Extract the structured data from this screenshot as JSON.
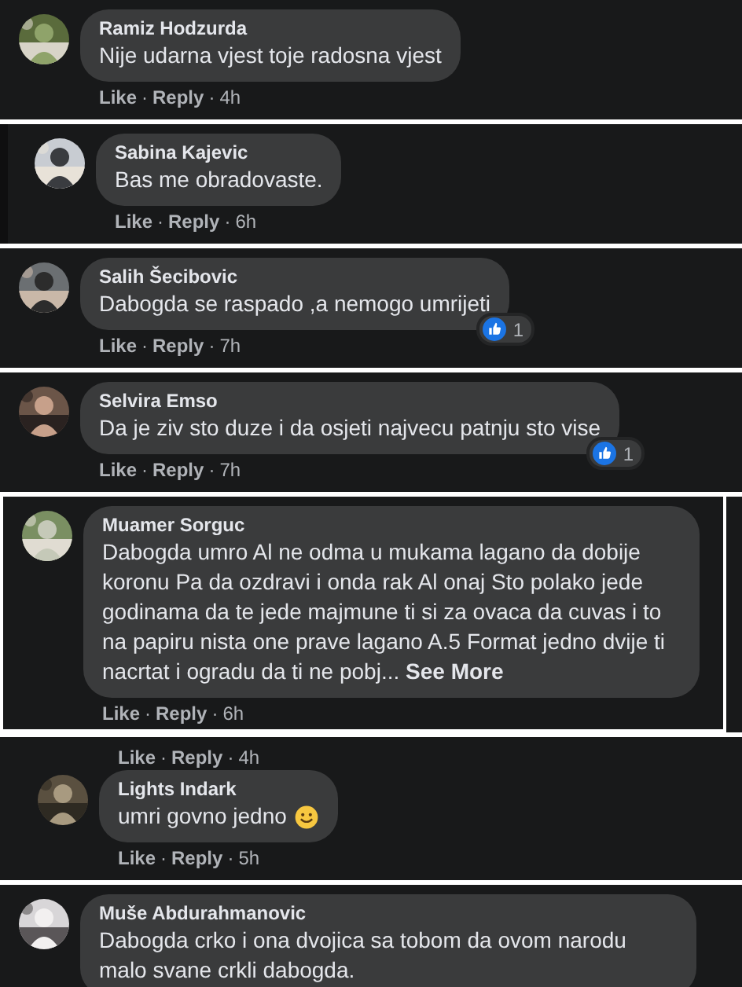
{
  "strips": [
    {
      "kind": "plain",
      "comment": {
        "reply": false,
        "author": "Ramiz Hodzurda",
        "text": "Nije udarna vjest toje radosna vjest",
        "actions": [
          {
            "kind": "link",
            "text": "Like"
          },
          {
            "kind": "dot",
            "text": "·"
          },
          {
            "kind": "link",
            "text": "Reply"
          },
          {
            "kind": "dot",
            "text": "·"
          },
          {
            "kind": "time",
            "text": "4h"
          }
        ]
      }
    },
    {
      "kind": "banded",
      "comment": {
        "reply": true,
        "author": "Sabina Kajevic",
        "text": "Bas me obradovaste.",
        "actions": [
          {
            "kind": "link",
            "text": "Like"
          },
          {
            "kind": "dot",
            "text": "·"
          },
          {
            "kind": "link",
            "text": "Reply"
          },
          {
            "kind": "dot",
            "text": "·"
          },
          {
            "kind": "time",
            "text": "6h"
          }
        ]
      }
    },
    {
      "kind": "plain",
      "comment": {
        "reply": false,
        "author": "Salih Šecibovic",
        "text": "Dabogda se raspado ,a nemogo umrijeti",
        "reaction_count": "1",
        "actions": [
          {
            "kind": "link",
            "text": "Like"
          },
          {
            "kind": "dot",
            "text": "·"
          },
          {
            "kind": "link",
            "text": "Reply"
          },
          {
            "kind": "dot",
            "text": "·"
          },
          {
            "kind": "time",
            "text": "7h"
          }
        ]
      }
    },
    {
      "kind": "plain",
      "comment": {
        "reply": false,
        "author": "Selvira Emso",
        "text": "Da je ziv sto duze i da osjeti najvecu patnju sto vise",
        "reaction_count": "1",
        "actions": [
          {
            "kind": "link",
            "text": "Like"
          },
          {
            "kind": "dot",
            "text": "·"
          },
          {
            "kind": "link",
            "text": "Reply"
          },
          {
            "kind": "dot",
            "text": "·"
          },
          {
            "kind": "time",
            "text": "7h"
          }
        ]
      }
    },
    {
      "kind": "framed",
      "comment": {
        "reply": false,
        "author": "Muamer Sorguc",
        "text": "Dabogda umro Al ne odma u mukama lagano da dobije koronu Pa da ozdravi i onda rak Al onaj Sto polako jede godinama da te jede majmune ti si za ovaca da cuvas i to na papiru nista one prave lagano A.5 Format jedno dvije ti nacrtat i ogradu da ti ne pobj...",
        "see_more": "See More",
        "actions": [
          {
            "kind": "link",
            "text": "Like"
          },
          {
            "kind": "dot",
            "text": "·"
          },
          {
            "kind": "link",
            "text": "Reply"
          },
          {
            "kind": "dot",
            "text": "·"
          },
          {
            "kind": "time",
            "text": "6h"
          }
        ]
      }
    },
    {
      "kind": "plain",
      "stray_actions": [
        {
          "kind": "link",
          "text": "Like"
        },
        {
          "kind": "dot",
          "text": "·"
        },
        {
          "kind": "link",
          "text": "Reply"
        },
        {
          "kind": "dot",
          "text": "·"
        },
        {
          "kind": "time",
          "text": "4h"
        }
      ],
      "comment": {
        "reply": true,
        "author": "Lights Indark",
        "text": "umri govno jedno",
        "emoji": true,
        "actions": [
          {
            "kind": "link",
            "text": "Like"
          },
          {
            "kind": "dot",
            "text": "·"
          },
          {
            "kind": "link",
            "text": "Reply"
          },
          {
            "kind": "dot",
            "text": "·"
          },
          {
            "kind": "time",
            "text": "5h"
          }
        ]
      }
    },
    {
      "kind": "plain",
      "comment": {
        "reply": false,
        "author": "Muše Abdurahmanovic",
        "text": "Dabogda crko i ona dvojica sa tobom da ovom narodu malo svane crkli dabogda."
      }
    }
  ]
}
